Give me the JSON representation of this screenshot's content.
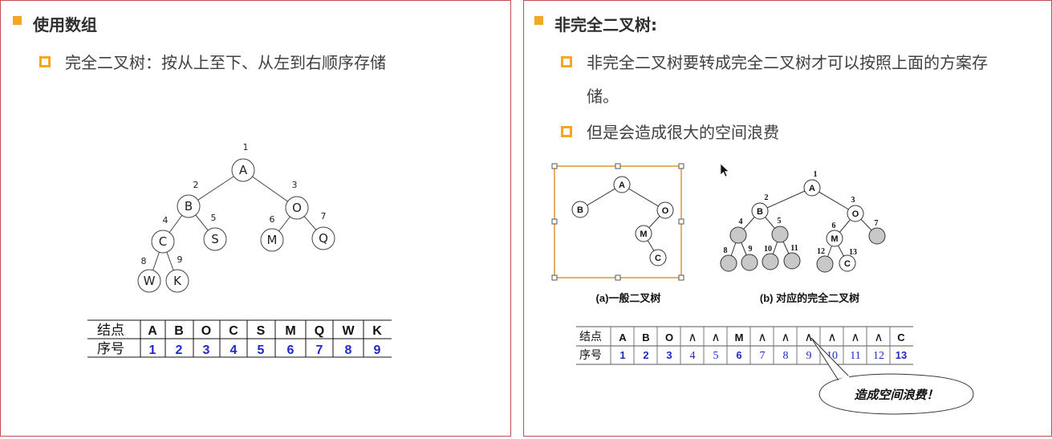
{
  "left": {
    "heading": "使用数组",
    "bullet": "完全二叉树：按从上至下、从左到右顺序存储",
    "tree": [
      {
        "label": "A",
        "num": "1"
      },
      {
        "label": "B",
        "num": "2"
      },
      {
        "label": "O",
        "num": "3"
      },
      {
        "label": "C",
        "num": "4"
      },
      {
        "label": "S",
        "num": "5"
      },
      {
        "label": "M",
        "num": "6"
      },
      {
        "label": "Q",
        "num": "7"
      },
      {
        "label": "W",
        "num": "8"
      },
      {
        "label": "K",
        "num": "9"
      }
    ],
    "table": {
      "row1_header": "结点",
      "row2_header": "序号",
      "nodes": [
        "A",
        "B",
        "O",
        "C",
        "S",
        "M",
        "Q",
        "W",
        "K"
      ],
      "indices": [
        "1",
        "2",
        "3",
        "4",
        "5",
        "6",
        "7",
        "8",
        "9"
      ]
    }
  },
  "right": {
    "heading": "非完全二叉树:",
    "bullet1_line1": "非完全二叉树要转成完全二叉树才可以按照上面的方案存",
    "bullet1_line2": "储。",
    "bullet2": "但是会造成很大的空间浪费",
    "fig_a": {
      "caption": "(a)一般二叉树",
      "nodes": [
        "A",
        "B",
        "O",
        "M",
        "C"
      ]
    },
    "fig_b": {
      "caption": "(b) 对应的完全二叉树",
      "labels": [
        "A",
        "B",
        "O",
        "M",
        "C"
      ],
      "nums": [
        "1",
        "2",
        "3",
        "4",
        "5",
        "6",
        "7",
        "8",
        "9",
        "10",
        "11",
        "12",
        "13"
      ]
    },
    "table": {
      "row1_header": "结点",
      "row2_header": "序号",
      "nodes": [
        "A",
        "B",
        "O",
        "∧",
        "∧",
        "M",
        "∧",
        "∧",
        "∧",
        "∧",
        "∧",
        "∧",
        "C"
      ],
      "indices": [
        "1",
        "2",
        "3",
        "4",
        "5",
        "6",
        "7",
        "8",
        "9",
        "10",
        "11",
        "12",
        "13"
      ]
    },
    "callout": "造成空间浪费！"
  },
  "colors": {
    "accent": "#f5a623",
    "border": "#c0504d",
    "index_blue": "#1f28c8",
    "null_red": "#e02020",
    "gray_node": "#c8c8c8"
  }
}
